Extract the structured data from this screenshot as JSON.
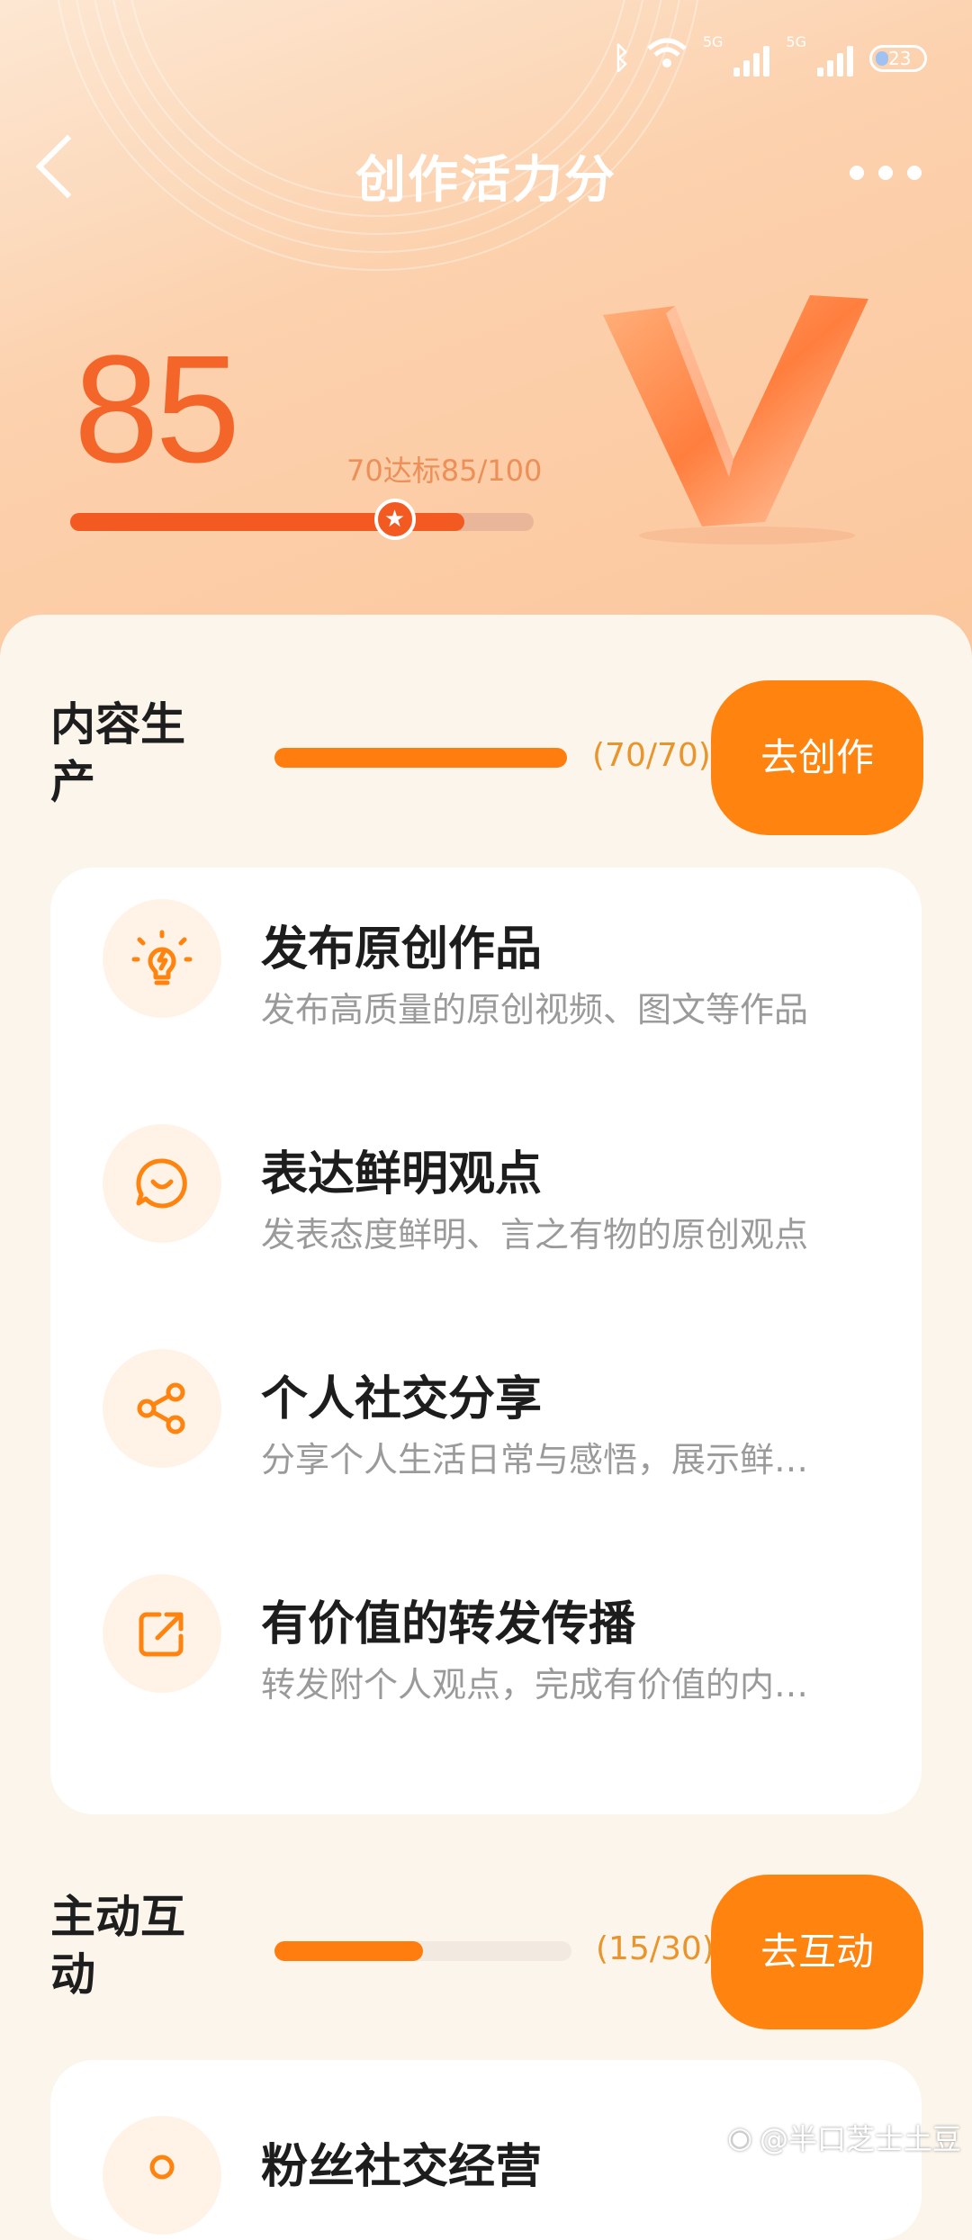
{
  "status": {
    "network1": "5G",
    "network2": "5G",
    "battery": "23"
  },
  "header": {
    "title": "创作活力分",
    "score": "85",
    "target_text": "70达标85/100",
    "progress": 0.85,
    "star_position": 0.7
  },
  "sections": [
    {
      "title": "内容生产",
      "count": "(70/70)",
      "progress": 1.0,
      "button": "去创作",
      "items": [
        {
          "icon": "bulb-icon",
          "title": "发布原创作品",
          "desc": "发布高质量的原创视频、图文等作品"
        },
        {
          "icon": "chat-smile-icon",
          "title": "表达鲜明观点",
          "desc": "发表态度鲜明、言之有物的原创观点"
        },
        {
          "icon": "share-icon",
          "title": "个人社交分享",
          "desc": "分享个人生活日常与感悟，展示鲜…"
        },
        {
          "icon": "forward-icon",
          "title": "有价值的转发传播",
          "desc": "转发附个人观点，完成有价值的内…"
        }
      ]
    },
    {
      "title": "主动互动",
      "count": "(15/30)",
      "progress": 0.5,
      "button": "去互动",
      "items": [
        {
          "icon": "fans-icon",
          "title": "粉丝社交经营",
          "desc": ""
        }
      ]
    }
  ],
  "watermark": "@半口芝士土豆",
  "colors": {
    "accent": "#ff840f",
    "score": "#f4652a",
    "bar_bg": "#f2e9e0"
  }
}
